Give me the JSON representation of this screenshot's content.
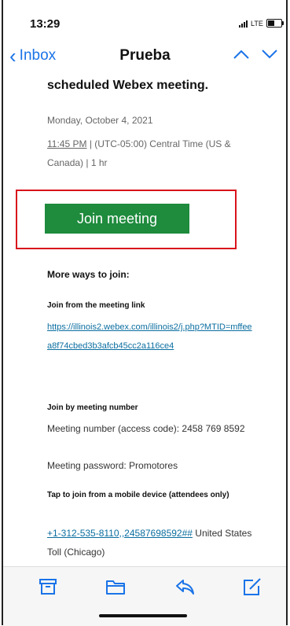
{
  "status_bar": {
    "time": "13:29",
    "network": "LTE"
  },
  "nav": {
    "back_label": "Inbox",
    "title": "Prueba"
  },
  "email": {
    "heading": "scheduled Webex meeting.",
    "date": "Monday, October 4, 2021",
    "time_start": "11:45 PM",
    "time_rest": " | (UTC-05:00) Central Time (US & Canada) | 1 hr",
    "join_button": "Join meeting",
    "more_ways": "More ways to join:",
    "link_section_title": "Join from the meeting link",
    "meeting_link": "https://illinois2.webex.com/illinois2/j.php?MTID=mffeea8f74cbed3b3afcb45cc2a116ce4",
    "number_section_title": "Join by meeting number",
    "meeting_number": "Meeting number (access code): 2458 769 8592",
    "meeting_password": "Meeting password: Promotores",
    "mobile_section_title": "Tap to join from a mobile device (attendees only)",
    "mobile_number": "+1-312-535-8110,,24587698592##",
    "mobile_number_suffix": " United States Toll (Chicago)"
  },
  "toolbar": {
    "icons": [
      "archive-icon",
      "folder-icon",
      "reply-icon",
      "compose-icon"
    ]
  },
  "colors": {
    "accent": "#1a73e8",
    "join_button": "#1e8b3d",
    "highlight_box": "#d9131b",
    "link": "#0b6ea0"
  }
}
